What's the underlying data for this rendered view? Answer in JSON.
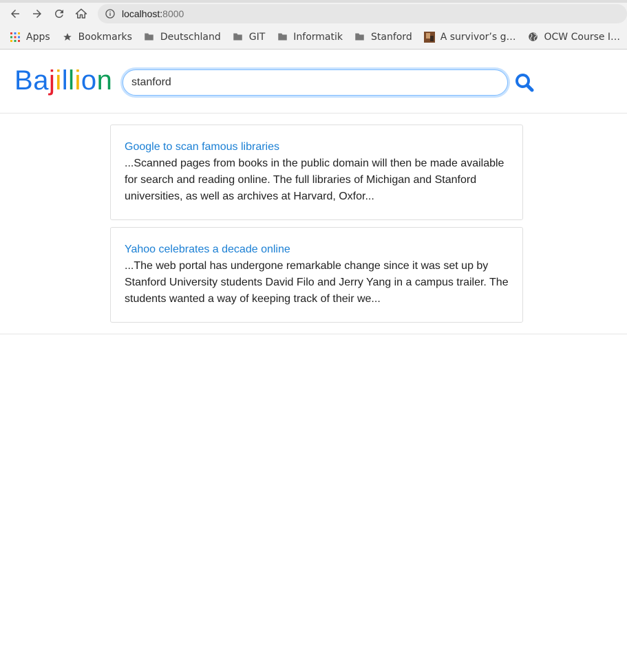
{
  "browser": {
    "url_host": "localhost:",
    "url_port": "8000",
    "bookmarks": [
      {
        "label": "Apps",
        "icon": "apps-grid-icon"
      },
      {
        "label": "Bookmarks",
        "icon": "star-icon"
      },
      {
        "label": "Deutschland",
        "icon": "folder-icon"
      },
      {
        "label": "GIT",
        "icon": "folder-icon"
      },
      {
        "label": "Informatik",
        "icon": "folder-icon"
      },
      {
        "label": "Stanford",
        "icon": "folder-icon"
      },
      {
        "label": "A survivor’s g…",
        "icon": "favicon-image-icon"
      },
      {
        "label": "OCW Course I…",
        "icon": "globe-icon"
      }
    ]
  },
  "header": {
    "logo_letters": [
      "B",
      "a",
      "j",
      "i",
      "l",
      "l",
      "i",
      "o",
      "n"
    ],
    "logo_colors": [
      "#1a73e8",
      "#1a73e8",
      "#e8202f",
      "#f4b400",
      "#1a73e8",
      "#0f9d58",
      "#f4b400",
      "#1a73e8",
      "#0f9d58"
    ],
    "search_value": "stanford",
    "search_icon": "search-icon",
    "accent_color": "#1a73e8"
  },
  "results": [
    {
      "title": "Google to scan famous libraries",
      "snippet": "...Scanned pages from books in the public domain will then be made available for search and reading online. The full libraries of Michigan and Stanford universities, as well as archives at Harvard, Oxfor..."
    },
    {
      "title": "Yahoo celebrates a decade online",
      "snippet": "...The web portal has undergone remarkable change since it was set up by Stanford University students David Filo and Jerry Yang in a campus trailer. The students wanted a way of keeping track of their we..."
    }
  ]
}
